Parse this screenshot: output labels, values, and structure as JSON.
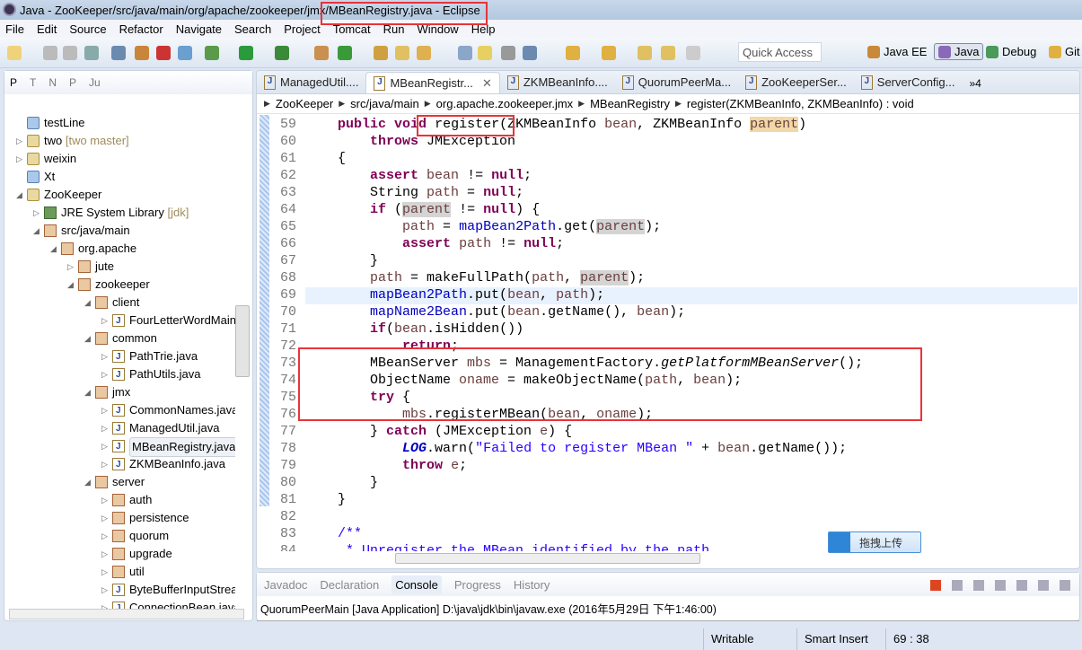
{
  "window_title": "Java - ZooKeeper/src/java/main/org/apache/zookeeper/jmx/MBeanRegistry.java - Eclipse",
  "menu": [
    "File",
    "Edit",
    "Source",
    "Refactor",
    "Navigate",
    "Search",
    "Project",
    "Tomcat",
    "Run",
    "Window",
    "Help"
  ],
  "quick_access_placeholder": "Quick Access",
  "perspectives": [
    "Java EE",
    "Java",
    "Debug",
    "Git"
  ],
  "left_panel": {
    "tabs": [
      "P",
      "T",
      "N",
      "P",
      "Ju"
    ],
    "tree": [
      {
        "label": "testLine",
        "level": 0,
        "twisty": "none",
        "icon": "folder"
      },
      {
        "label": "two",
        "decoration": "[two master]",
        "level": 0,
        "twisty": "closed",
        "icon": "project"
      },
      {
        "label": "weixin",
        "level": 0,
        "twisty": "closed",
        "icon": "project"
      },
      {
        "label": "Xt",
        "level": 0,
        "twisty": "none",
        "icon": "folder"
      },
      {
        "label": "ZooKeeper",
        "level": 0,
        "twisty": "open",
        "icon": "project"
      },
      {
        "label": "JRE System Library",
        "decoration": "[jdk]",
        "level": 1,
        "twisty": "closed",
        "icon": "lib"
      },
      {
        "label": "src/java/main",
        "level": 1,
        "twisty": "open",
        "icon": "pkg"
      },
      {
        "label": "org.apache",
        "level": 2,
        "twisty": "open",
        "icon": "pkg"
      },
      {
        "label": "jute",
        "level": 3,
        "twisty": "closed",
        "icon": "pkg"
      },
      {
        "label": "zookeeper",
        "level": 3,
        "twisty": "open",
        "icon": "pkg"
      },
      {
        "label": "client",
        "level": 4,
        "twisty": "open",
        "icon": "pkg"
      },
      {
        "label": "FourLetterWordMain",
        "level": 5,
        "twisty": "closed",
        "icon": "java"
      },
      {
        "label": "common",
        "level": 4,
        "twisty": "open",
        "icon": "pkg"
      },
      {
        "label": "PathTrie.java",
        "level": 5,
        "twisty": "closed",
        "icon": "java"
      },
      {
        "label": "PathUtils.java",
        "level": 5,
        "twisty": "closed",
        "icon": "java"
      },
      {
        "label": "jmx",
        "level": 4,
        "twisty": "open",
        "icon": "pkg"
      },
      {
        "label": "CommonNames.java",
        "level": 5,
        "twisty": "closed",
        "icon": "java"
      },
      {
        "label": "ManagedUtil.java",
        "level": 5,
        "twisty": "closed",
        "icon": "java"
      },
      {
        "label": "MBeanRegistry.java",
        "level": 5,
        "twisty": "closed",
        "icon": "java",
        "selected": true
      },
      {
        "label": "ZKMBeanInfo.java",
        "level": 5,
        "twisty": "closed",
        "icon": "java"
      },
      {
        "label": "server",
        "level": 4,
        "twisty": "open",
        "icon": "pkg"
      },
      {
        "label": "auth",
        "level": 5,
        "twisty": "closed",
        "icon": "pkg"
      },
      {
        "label": "persistence",
        "level": 5,
        "twisty": "closed",
        "icon": "pkg"
      },
      {
        "label": "quorum",
        "level": 5,
        "twisty": "closed",
        "icon": "pkg"
      },
      {
        "label": "upgrade",
        "level": 5,
        "twisty": "closed",
        "icon": "pkg"
      },
      {
        "label": "util",
        "level": 5,
        "twisty": "closed",
        "icon": "pkg"
      },
      {
        "label": "ByteBufferInputStream",
        "level": 5,
        "twisty": "closed",
        "icon": "java"
      },
      {
        "label": "ConnectionBean.java",
        "level": 5,
        "twisty": "closed",
        "icon": "java"
      }
    ]
  },
  "editor": {
    "tabs": [
      {
        "label": "ManagedUtil...."
      },
      {
        "label": "MBeanRegistr...",
        "active": true
      },
      {
        "label": "ZKMBeanInfo...."
      },
      {
        "label": "QuorumPeerMa..."
      },
      {
        "label": "ZooKeeperSer..."
      },
      {
        "label": "ServerConfig..."
      }
    ],
    "overflow_count": "»4",
    "breadcrumb": [
      "ZooKeeper",
      "src/java/main",
      "org.apache.zookeeper.jmx",
      "MBeanRegistry",
      "register(ZKMBeanInfo, ZKMBeanInfo) : void"
    ],
    "current_line": 69,
    "lines": [
      {
        "n": 59,
        "tokens": [
          [
            "    ",
            ""
          ],
          [
            "public",
            "kw"
          ],
          [
            " ",
            ""
          ],
          [
            "void",
            "kw"
          ],
          [
            " register(ZKMBeanInfo ",
            ""
          ],
          [
            "bean",
            "var"
          ],
          [
            ", ZKMBeanInfo ",
            ""
          ],
          [
            "parent",
            "var occw"
          ],
          [
            ")",
            ""
          ]
        ]
      },
      {
        "n": 60,
        "tokens": [
          [
            "        ",
            ""
          ],
          [
            "throws",
            "kw"
          ],
          [
            " JMException",
            ""
          ]
        ]
      },
      {
        "n": 61,
        "tokens": [
          [
            "    {",
            ""
          ]
        ]
      },
      {
        "n": 62,
        "tokens": [
          [
            "        ",
            ""
          ],
          [
            "assert",
            "kw"
          ],
          [
            " ",
            ""
          ],
          [
            "bean",
            "var"
          ],
          [
            " != ",
            ""
          ],
          [
            "null",
            "kw"
          ],
          [
            ";",
            ""
          ]
        ]
      },
      {
        "n": 63,
        "tokens": [
          [
            "        String ",
            ""
          ],
          [
            "path",
            "var"
          ],
          [
            " = ",
            ""
          ],
          [
            "null",
            "kw"
          ],
          [
            ";",
            ""
          ]
        ]
      },
      {
        "n": 64,
        "tokens": [
          [
            "        ",
            ""
          ],
          [
            "if",
            "kw"
          ],
          [
            " (",
            ""
          ],
          [
            "parent",
            "var occ"
          ],
          [
            " != ",
            ""
          ],
          [
            "null",
            "kw"
          ],
          [
            ") {",
            ""
          ]
        ]
      },
      {
        "n": 65,
        "tokens": [
          [
            "            ",
            ""
          ],
          [
            "path",
            "var"
          ],
          [
            " = ",
            ""
          ],
          [
            "mapBean2Path",
            "fld"
          ],
          [
            ".get(",
            ""
          ],
          [
            "parent",
            "var occ"
          ],
          [
            ");",
            ""
          ]
        ]
      },
      {
        "n": 66,
        "tokens": [
          [
            "            ",
            ""
          ],
          [
            "assert",
            "kw"
          ],
          [
            " ",
            ""
          ],
          [
            "path",
            "var"
          ],
          [
            " != ",
            ""
          ],
          [
            "null",
            "kw"
          ],
          [
            ";",
            ""
          ]
        ]
      },
      {
        "n": 67,
        "tokens": [
          [
            "        }",
            ""
          ]
        ]
      },
      {
        "n": 68,
        "tokens": [
          [
            "        ",
            ""
          ],
          [
            "path",
            "var"
          ],
          [
            " = makeFullPath(",
            ""
          ],
          [
            "path",
            "var"
          ],
          [
            ", ",
            ""
          ],
          [
            "parent",
            "var occ"
          ],
          [
            ");",
            ""
          ]
        ]
      },
      {
        "n": 69,
        "tokens": [
          [
            "        ",
            ""
          ],
          [
            "mapBean2Path",
            "fld"
          ],
          [
            ".put(",
            ""
          ],
          [
            "bean",
            "var"
          ],
          [
            ", ",
            ""
          ],
          [
            "path",
            "var"
          ],
          [
            ");",
            ""
          ]
        ]
      },
      {
        "n": 70,
        "tokens": [
          [
            "        ",
            ""
          ],
          [
            "mapName2Bean",
            "fld"
          ],
          [
            ".put(",
            ""
          ],
          [
            "bean",
            "var"
          ],
          [
            ".getName(), ",
            ""
          ],
          [
            "bean",
            "var"
          ],
          [
            ");",
            ""
          ]
        ]
      },
      {
        "n": 71,
        "tokens": [
          [
            "        ",
            ""
          ],
          [
            "if",
            "kw"
          ],
          [
            "(",
            ""
          ],
          [
            "bean",
            "var"
          ],
          [
            ".isHidden())",
            ""
          ]
        ]
      },
      {
        "n": 72,
        "tokens": [
          [
            "            ",
            ""
          ],
          [
            "return",
            "kw"
          ],
          [
            ";",
            ""
          ]
        ]
      },
      {
        "n": 73,
        "tokens": [
          [
            "        MBeanServer ",
            ""
          ],
          [
            "mbs",
            "var"
          ],
          [
            " = ManagementFactory.",
            ""
          ],
          [
            "getPlatformMBeanServer",
            "it"
          ],
          [
            "();",
            ""
          ]
        ]
      },
      {
        "n": 74,
        "tokens": [
          [
            "        ObjectName ",
            ""
          ],
          [
            "oname",
            "var"
          ],
          [
            " = makeObjectName(",
            ""
          ],
          [
            "path",
            "var"
          ],
          [
            ", ",
            ""
          ],
          [
            "bean",
            "var"
          ],
          [
            ");",
            ""
          ]
        ]
      },
      {
        "n": 75,
        "tokens": [
          [
            "        ",
            ""
          ],
          [
            "try",
            "kw"
          ],
          [
            " {",
            ""
          ]
        ]
      },
      {
        "n": 76,
        "tokens": [
          [
            "            ",
            ""
          ],
          [
            "mbs",
            "var"
          ],
          [
            ".registerMBean(",
            ""
          ],
          [
            "bean",
            "var"
          ],
          [
            ", ",
            ""
          ],
          [
            "oname",
            "var"
          ],
          [
            ");",
            ""
          ]
        ]
      },
      {
        "n": 77,
        "tokens": [
          [
            "        } ",
            ""
          ],
          [
            "catch",
            "kw"
          ],
          [
            " (JMException ",
            ""
          ],
          [
            "e",
            "var"
          ],
          [
            ") {",
            ""
          ]
        ]
      },
      {
        "n": 78,
        "tokens": [
          [
            "            ",
            ""
          ],
          [
            "LOG",
            "sfld"
          ],
          [
            ".warn(",
            ""
          ],
          [
            "\"Failed to register MBean \"",
            "str"
          ],
          [
            " + ",
            ""
          ],
          [
            "bean",
            "var"
          ],
          [
            ".getName());",
            ""
          ]
        ]
      },
      {
        "n": 79,
        "tokens": [
          [
            "            ",
            ""
          ],
          [
            "throw",
            "kw"
          ],
          [
            " ",
            ""
          ],
          [
            "e",
            "var"
          ],
          [
            ";",
            ""
          ]
        ]
      },
      {
        "n": 80,
        "tokens": [
          [
            "        }",
            ""
          ]
        ]
      },
      {
        "n": 81,
        "tokens": [
          [
            "    }",
            ""
          ]
        ]
      },
      {
        "n": 82,
        "tokens": [
          [
            "",
            ""
          ]
        ]
      },
      {
        "n": 83,
        "tokens": [
          [
            "    /**",
            "str"
          ]
        ]
      },
      {
        "n": 84,
        "tokens": [
          [
            "     * Unregister the MBean identified by the path",
            "str"
          ]
        ]
      }
    ],
    "upload_button": "拖拽上传"
  },
  "bottom_panel": {
    "tabs": [
      "Javadoc",
      "Declaration",
      "Console",
      "Progress",
      "History"
    ],
    "active_tab": "Console",
    "console_text": "QuorumPeerMain [Java Application] D:\\java\\jdk\\bin\\javaw.exe (2016年5月29日 下午1:46:00)"
  },
  "status_bar": {
    "mode": "Writable",
    "insert": "Smart Insert",
    "position": "69 : 38"
  },
  "colors": {
    "annotation_box": "#e8333a",
    "keyword": "#7f0055",
    "field": "#0000c0",
    "string": "#2a00ff",
    "current_line": "#e8f2fe"
  }
}
